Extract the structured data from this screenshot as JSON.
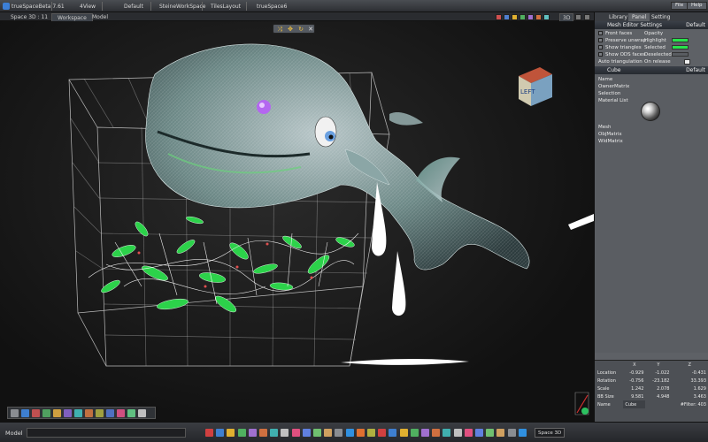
{
  "titlebar": {
    "app_title": "trueSpaceBeta 7.61",
    "menus": [
      "4View",
      "Default",
      "SteineWorkSpace",
      "TilesLayout",
      "trueSpace6"
    ],
    "buttons": [
      "File",
      "Help"
    ]
  },
  "tabs_bar": {
    "space_label": "Space 3D : 11",
    "tabs": [
      "Workspace",
      "Model"
    ],
    "mode_3d": "3D"
  },
  "viewport": {
    "nav_cube_label": "LEFT"
  },
  "right_panel": {
    "tabs": [
      "Library",
      "Panel",
      "Setting"
    ],
    "mesh_editor": {
      "title": "Mesh Editor Settings",
      "default_label": "Default",
      "rows": [
        {
          "label": "Front faces",
          "right": "Opacity"
        },
        {
          "label": "Preserve unwrap",
          "right": "Highlight"
        },
        {
          "label": "Show triangles",
          "right": "Selected"
        },
        {
          "label": "Show ODS faces",
          "right": "Deselected"
        },
        {
          "label": "Auto triangulation",
          "right": "On release"
        }
      ]
    },
    "object": {
      "title": "Cube",
      "default_label": "Default",
      "props": [
        "Name",
        "OwnerMatrix",
        "Selection",
        "Material List",
        "Mesh",
        "ObjMatrix",
        "WldMatrix"
      ]
    },
    "transform": {
      "axes": [
        "X",
        "Y",
        "Z"
      ],
      "rows": [
        {
          "label": "Location",
          "values": [
            "-0.929",
            "-1.022",
            "-0.431"
          ]
        },
        {
          "label": "Rotation",
          "values": [
            "-0.756",
            "-23.182",
            "33.393"
          ]
        },
        {
          "label": "Scale",
          "values": [
            "1.242",
            "2.078",
            "1.629"
          ]
        },
        {
          "label": "BB Size",
          "values": [
            "9.581",
            "4.948",
            "3.463"
          ]
        }
      ],
      "name_label": "Name",
      "name_value": "Cube",
      "filter_label": "#Filter: 403"
    }
  },
  "statusbar": {
    "label": "Model",
    "space_mode": "Space 3D"
  },
  "colors": {
    "accent_green": "#27e34b",
    "panel_bg": "#5e6166",
    "header_bg": "#2d3036"
  }
}
